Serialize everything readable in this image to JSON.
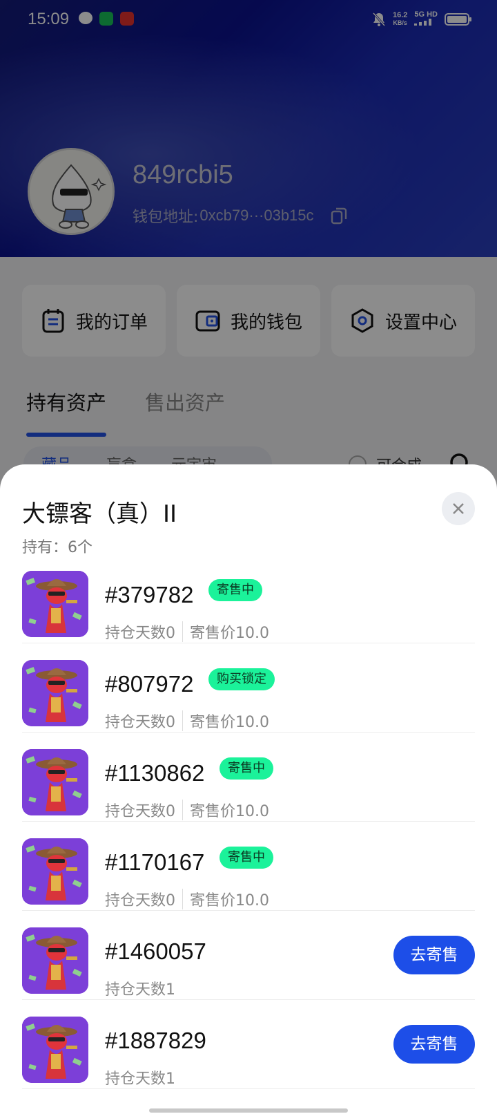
{
  "status_bar": {
    "time": "15:09",
    "net_speed_value": "16.2",
    "net_speed_unit": "KB/s",
    "network": "5G HD"
  },
  "profile": {
    "username": "849rcbi5",
    "wallet_label": "钱包地址:",
    "wallet_address": "0xcb79···03b15c"
  },
  "actions": [
    {
      "label": "我的订单",
      "icon": "order-icon"
    },
    {
      "label": "我的钱包",
      "icon": "wallet-icon"
    },
    {
      "label": "设置中心",
      "icon": "settings-icon"
    }
  ],
  "tabs": {
    "held": "持有资产",
    "sold": "售出资产"
  },
  "filters": [
    "藏品",
    "盲盒",
    "元宇宙"
  ],
  "merge_label": "可合成",
  "sheet": {
    "title": "大镖客（真）II",
    "count": "持有：6个",
    "items": [
      {
        "serial": "#379782",
        "badge": "寄售中",
        "days": "持仓天数0",
        "price": "寄售价10.0",
        "button": ""
      },
      {
        "serial": "#807972",
        "badge": "购买锁定",
        "days": "持仓天数0",
        "price": "寄售价10.0",
        "button": ""
      },
      {
        "serial": "#1130862",
        "badge": "寄售中",
        "days": "持仓天数0",
        "price": "寄售价10.0",
        "button": ""
      },
      {
        "serial": "#1170167",
        "badge": "寄售中",
        "days": "持仓天数0",
        "price": "寄售价10.0",
        "button": ""
      },
      {
        "serial": "#1460057",
        "badge": "",
        "days": "持仓天数1",
        "price": "",
        "button": "去寄售"
      },
      {
        "serial": "#1887829",
        "badge": "",
        "days": "持仓天数1",
        "price": "",
        "button": "去寄售"
      }
    ]
  },
  "colors": {
    "accent": "#1d4ee8",
    "badge": "#1bf29a",
    "header_dark": "#0b128f"
  }
}
